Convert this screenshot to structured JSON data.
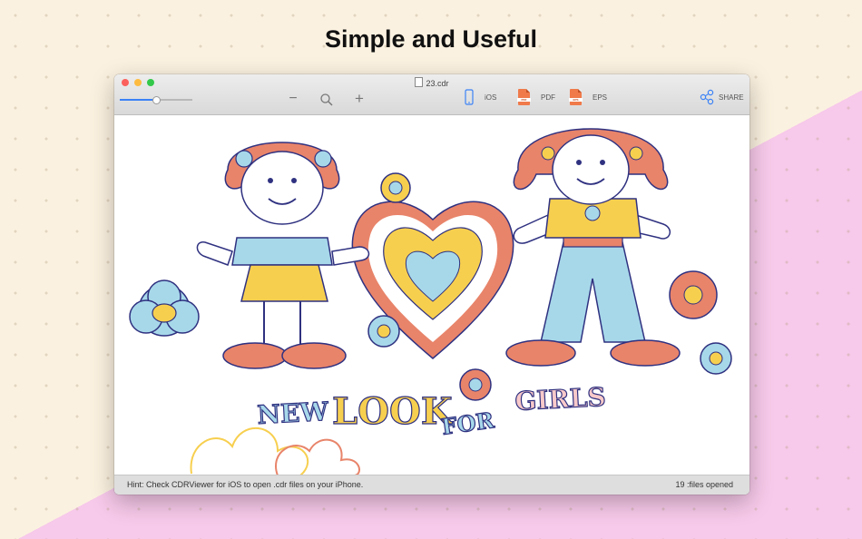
{
  "headline": "Simple and Useful",
  "window": {
    "title": "23.cdr",
    "zoom_level": 0.5
  },
  "toolbar": {
    "ios_label": "iOS",
    "pdf_label": "PDF",
    "pdf_icon_text": "PDF",
    "eps_label": "EPS",
    "eps_icon_text": "EPS",
    "share_label": "SHARE",
    "icons": [
      "zoom-out-icon",
      "magnifier-icon",
      "zoom-in-icon",
      "phone-icon",
      "pdf-file-icon",
      "eps-file-icon",
      "share-icon"
    ]
  },
  "artwork": {
    "words": [
      "NEW",
      "LOOK",
      "FOR",
      "GIRLS"
    ]
  },
  "status": {
    "hint": "Hint: Check CDRViewer for iOS to open .cdr files on your iPhone.",
    "count": "19 :files opened"
  },
  "colors": {
    "accent": "#3b82f6",
    "file_icon": "#f07a4a",
    "art_orange": "#e8846a",
    "art_yellow": "#f7cf4f",
    "art_blue": "#a7d8ea",
    "art_outline": "#2f3180",
    "bg_cream": "#fbf1e0",
    "bg_pink": "#f7c9ea"
  }
}
